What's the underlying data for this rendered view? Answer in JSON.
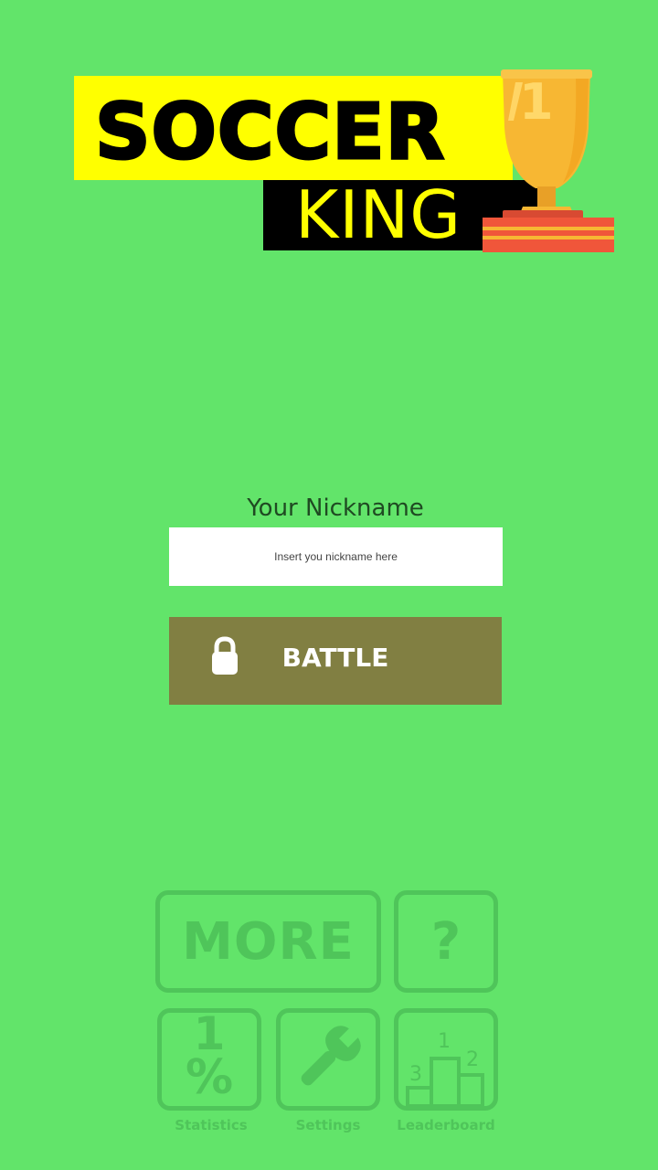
{
  "logo": {
    "line1": "SOCCER",
    "line2": "KING",
    "trophy_number": "1",
    "colors": {
      "yellow": "#ffff00",
      "black": "#000000",
      "trophy_gold": "#f7b733",
      "trophy_base": "#f0563a"
    }
  },
  "form": {
    "nickname_label": "Your Nickname",
    "nickname_placeholder": "Insert you nickname here",
    "nickname_value": "",
    "battle_label": "BATTLE",
    "battle_icon": "lock-icon",
    "battle_color": "#817f42"
  },
  "menu": {
    "more_label": "MORE",
    "help_label": "?",
    "statistics": {
      "glyph_top": "1",
      "glyph_bottom": "%",
      "caption": "Statistics"
    },
    "settings": {
      "icon": "wrench-icon",
      "caption": "Settings"
    },
    "leaderboard": {
      "icon": "podium-icon",
      "places": [
        "1",
        "2",
        "3"
      ],
      "caption": "Leaderboard"
    },
    "color": "#4fc55a"
  },
  "background_color": "#62e46a"
}
